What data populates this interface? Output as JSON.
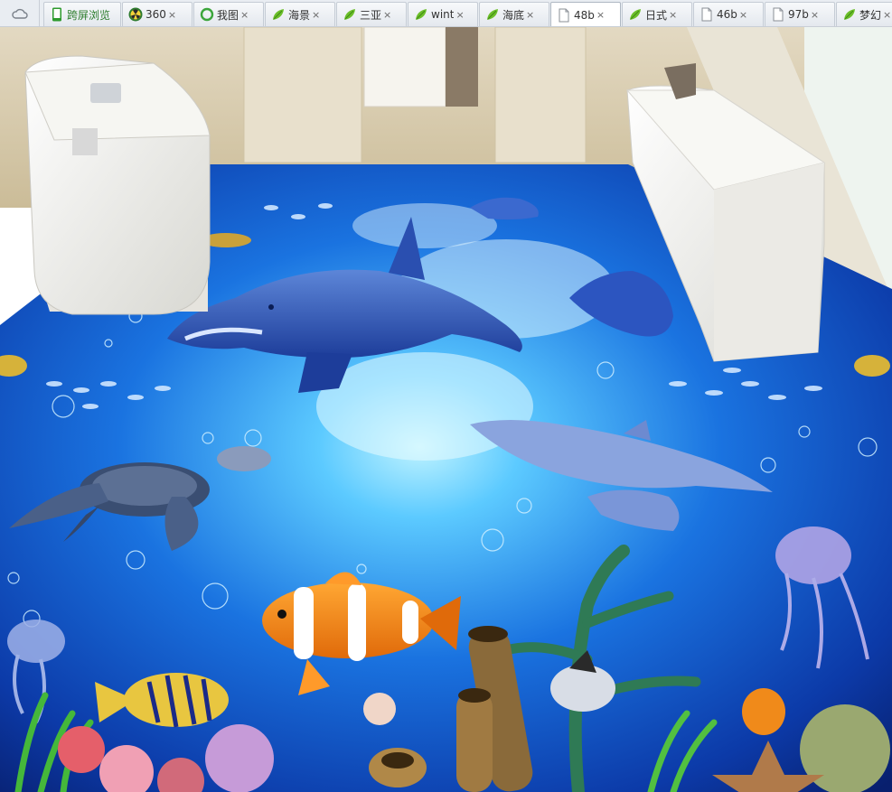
{
  "browser": {
    "tabs": [
      {
        "label": "跨屏浏览",
        "icon": "phone-icon",
        "closable": false,
        "active": false
      },
      {
        "label": "360",
        "icon": "radiation-icon",
        "closable": true,
        "active": false
      },
      {
        "label": "我图",
        "icon": "green-circle-icon",
        "closable": true,
        "active": false
      },
      {
        "label": "海景",
        "icon": "leaf-icon",
        "closable": true,
        "active": false
      },
      {
        "label": "三亚",
        "icon": "leaf-icon",
        "closable": true,
        "active": false
      },
      {
        "label": "wint",
        "icon": "leaf-icon",
        "closable": true,
        "active": false
      },
      {
        "label": "海底",
        "icon": "leaf-icon",
        "closable": true,
        "active": false
      },
      {
        "label": "48b",
        "icon": "page-icon",
        "closable": true,
        "active": true
      },
      {
        "label": "日式",
        "icon": "leaf-icon",
        "closable": true,
        "active": false
      },
      {
        "label": "46b",
        "icon": "page-icon",
        "closable": true,
        "active": false
      },
      {
        "label": "97b",
        "icon": "page-icon",
        "closable": true,
        "active": false
      },
      {
        "label": "梦幻",
        "icon": "leaf-icon",
        "closable": true,
        "active": false
      }
    ],
    "close_glyph": "×"
  },
  "colors": {
    "ocean_deep": "#0a2a8c",
    "ocean_mid": "#1560d8",
    "ocean_light": "#6fd3ff",
    "wall": "#d9ceb4",
    "porcelain": "#f3f3ef",
    "accent_green": "#2d9a2d"
  }
}
